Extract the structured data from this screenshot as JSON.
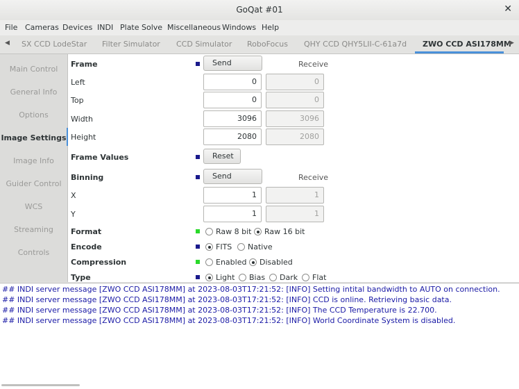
{
  "window": {
    "title": "GoQat #01"
  },
  "menu": [
    "File",
    "Cameras",
    "Devices",
    "INDI",
    "Plate Solve",
    "Miscellaneous",
    "Windows",
    "Help"
  ],
  "tabs": [
    "SX CCD LodeStar",
    "Filter Simulator",
    "CCD Simulator",
    "RoboFocus",
    "QHY CCD QHY5LII-C-61a7d",
    "ZWO CCD ASI178MM"
  ],
  "active_tab": "ZWO CCD ASI178MM",
  "sidebar": [
    "Main Control",
    "General Info",
    "Options",
    "Image Settings",
    "Image Info",
    "Guider Control",
    "WCS",
    "Streaming",
    "Controls"
  ],
  "active_section": "Image Settings",
  "frame": {
    "label": "Frame",
    "send": "Send",
    "receive": "Receive",
    "rows": [
      {
        "label": "Left",
        "value": "0",
        "recv": "0"
      },
      {
        "label": "Top",
        "value": "0",
        "recv": "0"
      },
      {
        "label": "Width",
        "value": "3096",
        "recv": "3096"
      },
      {
        "label": "Height",
        "value": "2080",
        "recv": "2080"
      }
    ]
  },
  "frame_values": {
    "label": "Frame Values",
    "reset": "Reset"
  },
  "binning": {
    "label": "Binning",
    "send": "Send",
    "receive": "Receive",
    "rows": [
      {
        "label": "X",
        "value": "1",
        "recv": "1"
      },
      {
        "label": "Y",
        "value": "1",
        "recv": "1"
      }
    ]
  },
  "format": {
    "label": "Format",
    "options": [
      "Raw 8 bit",
      "Raw 16 bit"
    ],
    "selected": "Raw 16 bit"
  },
  "encode": {
    "label": "Encode",
    "options": [
      "FITS",
      "Native"
    ],
    "selected": "FITS"
  },
  "compression": {
    "label": "Compression",
    "options": [
      "Enabled",
      "Disabled"
    ],
    "selected": "Disabled"
  },
  "type": {
    "label": "Type",
    "options": [
      "Light",
      "Bias",
      "Dark",
      "Flat"
    ],
    "selected": "Light"
  },
  "colors": {
    "led_blue": "#1a1a8c",
    "led_green": "#2ad92a",
    "log_text": "#1a1aa6",
    "accent": "#4a90d9"
  },
  "log": [
    "## INDI server message [ZWO CCD ASI178MM] at 2023-08-03T17:21:52: [INFO] Setting intital bandwidth to AUTO on connection.",
    "## INDI server message [ZWO CCD ASI178MM] at 2023-08-03T17:21:52: [INFO] CCD is online. Retrieving basic data.",
    "## INDI server message [ZWO CCD ASI178MM] at 2023-08-03T17:21:52: [INFO] The CCD Temperature is 22.700.",
    "## INDI server message [ZWO CCD ASI178MM] at 2023-08-03T17:21:52: [INFO] World Coordinate System is disabled."
  ]
}
